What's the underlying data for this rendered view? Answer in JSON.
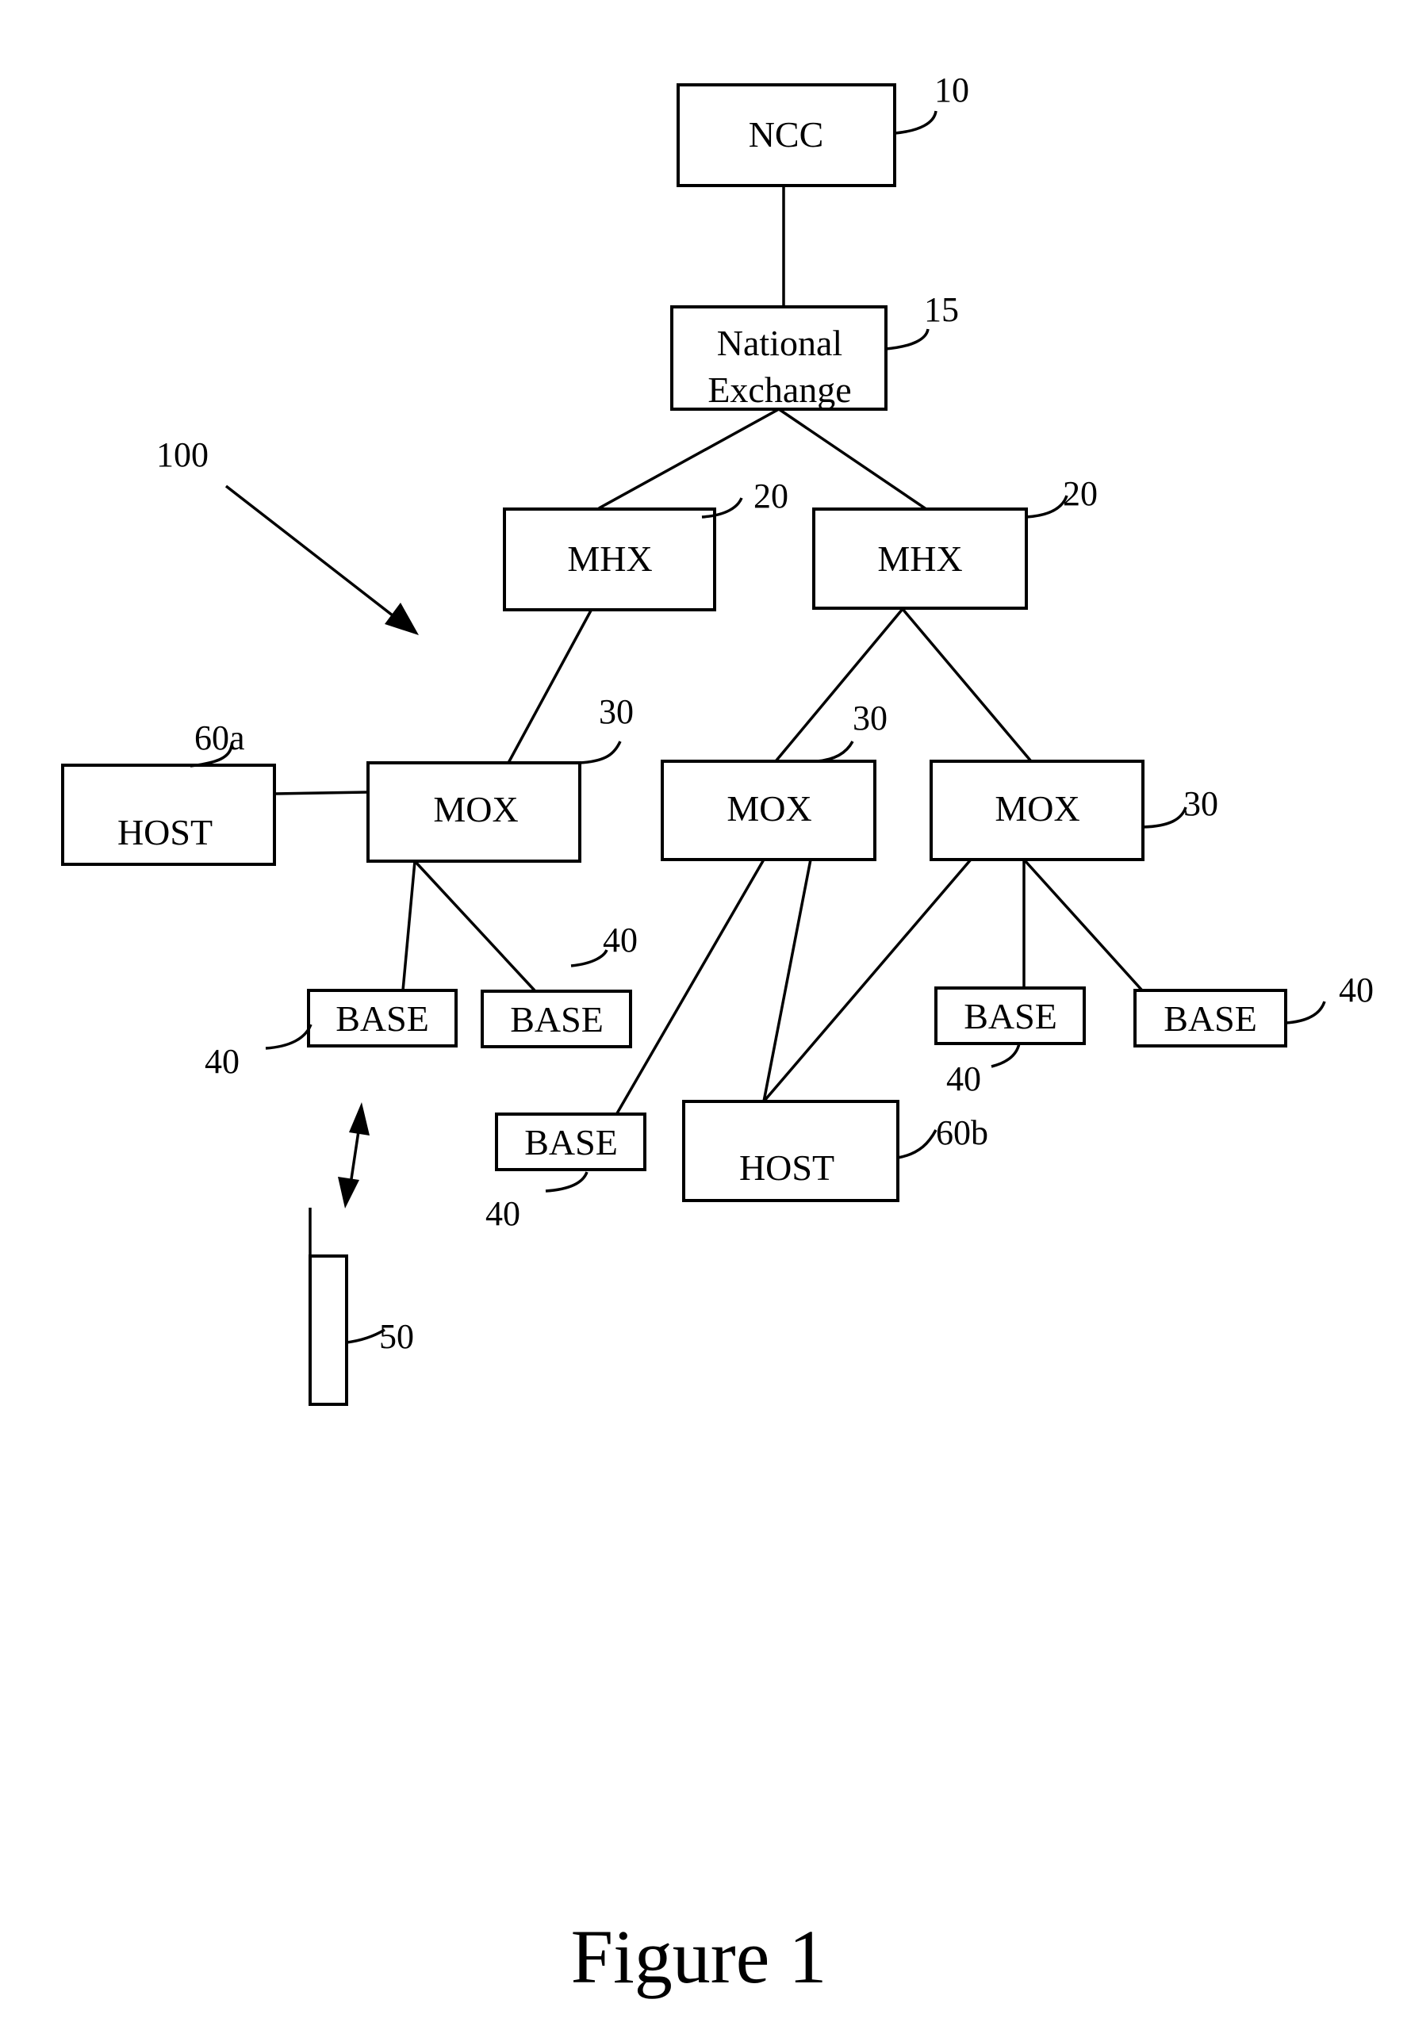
{
  "figure": {
    "caption": "Figure 1",
    "system_ref": "100"
  },
  "nodes": {
    "ncc": {
      "label": "NCC",
      "ref": "10"
    },
    "national_exchange": {
      "label_line1": "National",
      "label_line2": "Exchange",
      "ref": "15"
    },
    "mhx_left": {
      "label": "MHX",
      "ref": "20"
    },
    "mhx_right": {
      "label": "MHX",
      "ref": "20"
    },
    "mox_left": {
      "label": "MOX",
      "ref": "30"
    },
    "mox_mid": {
      "label": "MOX",
      "ref": "30"
    },
    "mox_right": {
      "label": "MOX",
      "ref": "30"
    },
    "host_a": {
      "label": "HOST",
      "ref": "60a"
    },
    "host_b": {
      "label": "HOST",
      "ref": "60b"
    },
    "base_1": {
      "label": "BASE",
      "ref": "40"
    },
    "base_2": {
      "label": "BASE",
      "ref": "40"
    },
    "base_3": {
      "label": "BASE",
      "ref": "40"
    },
    "base_4": {
      "label": "BASE",
      "ref": "40"
    },
    "base_5": {
      "label": "BASE",
      "ref": "40"
    },
    "device": {
      "ref": "50"
    }
  }
}
